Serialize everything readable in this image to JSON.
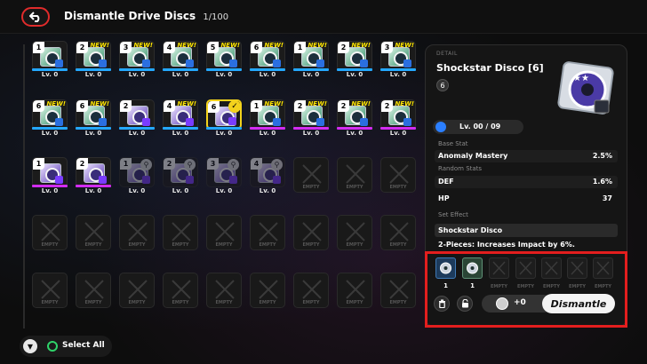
{
  "header": {
    "title": "Dismantle Drive Discs",
    "count": "1/100"
  },
  "grid": {
    "rows": [
      [
        {
          "tier": "1",
          "new": false,
          "bar": "blue",
          "lv": "Lv. 0",
          "style": "cd-green"
        },
        {
          "tier": "2",
          "new": true,
          "bar": "blue",
          "lv": "Lv. 0",
          "style": "cd-green"
        },
        {
          "tier": "3",
          "new": true,
          "bar": "blue",
          "lv": "Lv. 0",
          "style": "cd-green"
        },
        {
          "tier": "4",
          "new": true,
          "bar": "blue",
          "lv": "Lv. 0",
          "style": "cd-green"
        },
        {
          "tier": "5",
          "new": true,
          "bar": "blue",
          "lv": "Lv. 0",
          "style": "cd-green"
        },
        {
          "tier": "6",
          "new": true,
          "bar": "blue",
          "lv": "Lv. 0",
          "style": "cd-green"
        },
        {
          "tier": "1",
          "new": true,
          "bar": "blue",
          "lv": "Lv. 0",
          "style": "cd-green"
        },
        {
          "tier": "2",
          "new": true,
          "bar": "blue",
          "lv": "Lv. 0",
          "style": "cd-green"
        },
        {
          "tier": "3",
          "new": true,
          "bar": "blue",
          "lv": "Lv. 0",
          "style": "cd-green"
        }
      ],
      [
        {
          "tier": "6",
          "new": true,
          "bar": "blue",
          "lv": "Lv. 0",
          "style": "cd-green"
        },
        {
          "tier": "6",
          "new": true,
          "bar": "blue",
          "lv": "Lv. 0",
          "style": "cd-green"
        },
        {
          "tier": "2",
          "new": false,
          "bar": "blue",
          "lv": "Lv. 0",
          "style": "cd-purple"
        },
        {
          "tier": "4",
          "new": true,
          "bar": "blue",
          "lv": "Lv. 0",
          "style": "cd-purple"
        },
        {
          "tier": "6",
          "new": false,
          "bar": "blue",
          "lv": "Lv. 0",
          "style": "cd-purple",
          "selected": true
        },
        {
          "tier": "1",
          "new": true,
          "bar": "pink",
          "lv": "Lv. 0",
          "style": "cd-green"
        },
        {
          "tier": "2",
          "new": true,
          "bar": "pink",
          "lv": "Lv. 0",
          "style": "cd-green"
        },
        {
          "tier": "2",
          "new": true,
          "bar": "pink",
          "lv": "Lv. 0",
          "style": "cd-green"
        },
        {
          "tier": "2",
          "new": true,
          "bar": "pink",
          "lv": "Lv. 0",
          "style": "cd-green"
        }
      ],
      [
        {
          "tier": "1",
          "new": false,
          "bar": "pink",
          "lv": "Lv. 0",
          "style": "cd-purple"
        },
        {
          "tier": "2",
          "new": false,
          "bar": "pink",
          "lv": "Lv. 0",
          "style": "cd-purple"
        },
        {
          "tier": "1",
          "new": false,
          "bar": "",
          "lv": "Lv. 0",
          "style": "cd-purple",
          "dim": true,
          "locked": true
        },
        {
          "tier": "2",
          "new": false,
          "bar": "",
          "lv": "Lv. 0",
          "style": "cd-purple",
          "dim": true,
          "locked": true
        },
        {
          "tier": "3",
          "new": false,
          "bar": "",
          "lv": "Lv. 0",
          "style": "cd-purple",
          "dim": true,
          "locked": true
        },
        {
          "tier": "4",
          "new": false,
          "bar": "",
          "lv": "Lv. 0",
          "style": "cd-purple",
          "dim": true,
          "locked": true
        },
        {
          "empty": true
        },
        {
          "empty": true
        },
        {
          "empty": true
        }
      ],
      [
        {
          "empty": true
        },
        {
          "empty": true
        },
        {
          "empty": true
        },
        {
          "empty": true
        },
        {
          "empty": true
        },
        {
          "empty": true
        },
        {
          "empty": true
        },
        {
          "empty": true
        },
        {
          "empty": true
        }
      ],
      [
        {
          "empty": true
        },
        {
          "empty": true
        },
        {
          "empty": true
        },
        {
          "empty": true
        },
        {
          "empty": true
        },
        {
          "empty": true
        },
        {
          "empty": true
        },
        {
          "empty": true
        },
        {
          "empty": true
        }
      ]
    ],
    "new_label": "NEW!",
    "empty_label": "EMPTY"
  },
  "detail": {
    "section_label": "DETAIL",
    "name": "Shockstar Disco [6]",
    "rank": "6",
    "level": "Lv. 00 / 09",
    "base_stat_label": "Base Stat",
    "base_stat": {
      "name": "Anomaly Mastery",
      "value": "2.5%"
    },
    "random_stats_label": "Random Stats",
    "random_stats": [
      {
        "name": "DEF",
        "value": "1.6%"
      },
      {
        "name": "HP",
        "value": "37"
      }
    ],
    "set_effect_label": "Set Effect",
    "set_name": "Shockstar Disco",
    "set_desc": "2-Pieces: Increases Impact by 6%."
  },
  "tray": {
    "slots": [
      {
        "filled": true,
        "caption": "1"
      },
      {
        "filled": true,
        "caption": "1"
      },
      {
        "filled": false,
        "caption": "EMPTY"
      },
      {
        "filled": false,
        "caption": "EMPTY"
      },
      {
        "filled": false,
        "caption": "EMPTY"
      },
      {
        "filled": false,
        "caption": "EMPTY"
      },
      {
        "filled": false,
        "caption": "EMPTY"
      }
    ],
    "gain": "+0",
    "dismantle_label": "Dismantle"
  },
  "footer": {
    "select_all_label": "Select All"
  },
  "colors": {
    "accent": "#e31e1e",
    "blue_bar": "#24a8ff",
    "pink_bar": "#d22cf0",
    "selection": "#f3d21c"
  }
}
